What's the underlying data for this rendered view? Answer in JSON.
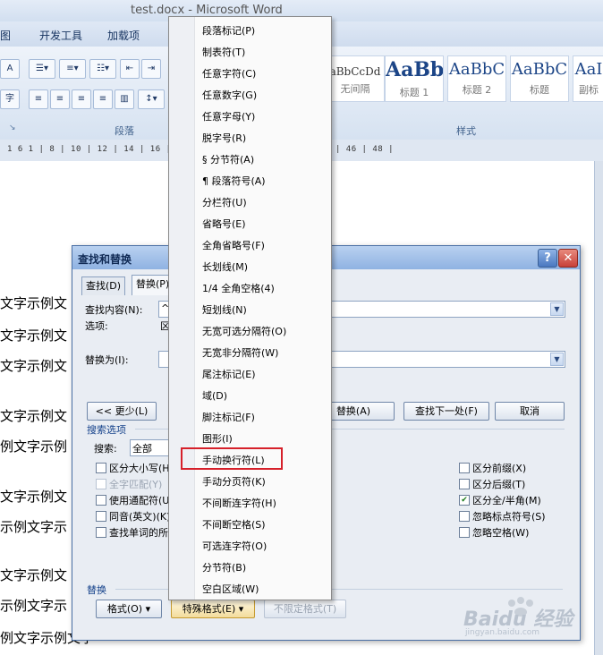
{
  "window": {
    "title": "test.docx - Microsoft Word"
  },
  "menubar": {
    "items": [
      "图",
      "开发工具",
      "加载项"
    ]
  },
  "ribbon": {
    "group_paragraph": "段落",
    "group_styles": "样式",
    "styles": [
      {
        "sample": "aBbCcDd",
        "name": "无间隔"
      },
      {
        "sample": "AaBb",
        "name": "标题 1"
      },
      {
        "sample": "AaBbC",
        "name": "标题 2"
      },
      {
        "sample": "AaBbC",
        "name": "标题"
      },
      {
        "sample": "AaI",
        "name": "副标"
      }
    ]
  },
  "ruler": {
    "ticks": "1 6 1 | 8 | 10 | 12 | 14 | 16 |                                | 34 | 36 | 38 | 40 | 42 | 44 | 46 | 48 |"
  },
  "document": {
    "lines": [
      "文字示例文",
      "文字示例文",
      "文字示例文",
      "文字示例文",
      "例文字示例",
      "文字示例文",
      "示例文字示",
      "文字示例文",
      "示例文字示",
      "例文字示例文字"
    ]
  },
  "dialog": {
    "title": "查找和替换",
    "help_label": "?",
    "close_label": "✕",
    "tabs": [
      "查找(D)",
      "替换(P)"
    ],
    "find_label": "查找内容(N):",
    "find_value": "^1",
    "options_label": "选项:",
    "options_value": "区",
    "replace_label": "替换为(I):",
    "less_button": "<< 更少(L)",
    "replace_button": "替换(A)",
    "find_next_button": "查找下一处(F)",
    "cancel_button": "取消",
    "search_options_header": "搜索选项",
    "search_label": "搜索:",
    "search_value": "全部",
    "checkboxes_left": [
      {
        "label": "区分大小写(H)",
        "checked": false,
        "disabled": false
      },
      {
        "label": "全字匹配(Y)",
        "checked": false,
        "disabled": true
      },
      {
        "label": "使用通配符(U)",
        "checked": false,
        "disabled": false
      },
      {
        "label": "同音(英文)(K)",
        "checked": false,
        "disabled": false
      },
      {
        "label": "查找单词的所",
        "checked": false,
        "disabled": false
      }
    ],
    "checkboxes_right": [
      {
        "label": "区分前缀(X)",
        "checked": false
      },
      {
        "label": "区分后缀(T)",
        "checked": false
      },
      {
        "label": "区分全/半角(M)",
        "checked": true
      },
      {
        "label": "忽略标点符号(S)",
        "checked": false
      },
      {
        "label": "忽略空格(W)",
        "checked": false
      }
    ],
    "replace_section": "替换",
    "format_button": "格式(O) ▾",
    "special_button": "特殊格式(E) ▾",
    "no_format_button": "不限定格式(T)"
  },
  "context_menu": {
    "items": [
      "段落标记(P)",
      "制表符(T)",
      "任意字符(C)",
      "任意数字(G)",
      "任意字母(Y)",
      "脱字号(R)",
      "§ 分节符(A)",
      "¶ 段落符号(A)",
      "分栏符(U)",
      "省略号(E)",
      "全角省略号(F)",
      "长划线(M)",
      "1/4 全角空格(4)",
      "短划线(N)",
      "无宽可选分隔符(O)",
      "无宽非分隔符(W)",
      "尾注标记(E)",
      "域(D)",
      "脚注标记(F)",
      "图形(I)",
      "手动换行符(L)",
      "手动分页符(K)",
      "不间断连字符(H)",
      "不间断空格(S)",
      "可选连字符(O)",
      "分节符(B)",
      "空白区域(W)"
    ],
    "highlighted": "手动换行符(L)"
  },
  "watermark": {
    "text": "Baidu 经验",
    "url_text": "jingyan.baidu.com"
  },
  "colors": {
    "highlight_border": "#d6202a",
    "dialog_title": "#8fb2e2",
    "close_button": "#c8413a"
  }
}
